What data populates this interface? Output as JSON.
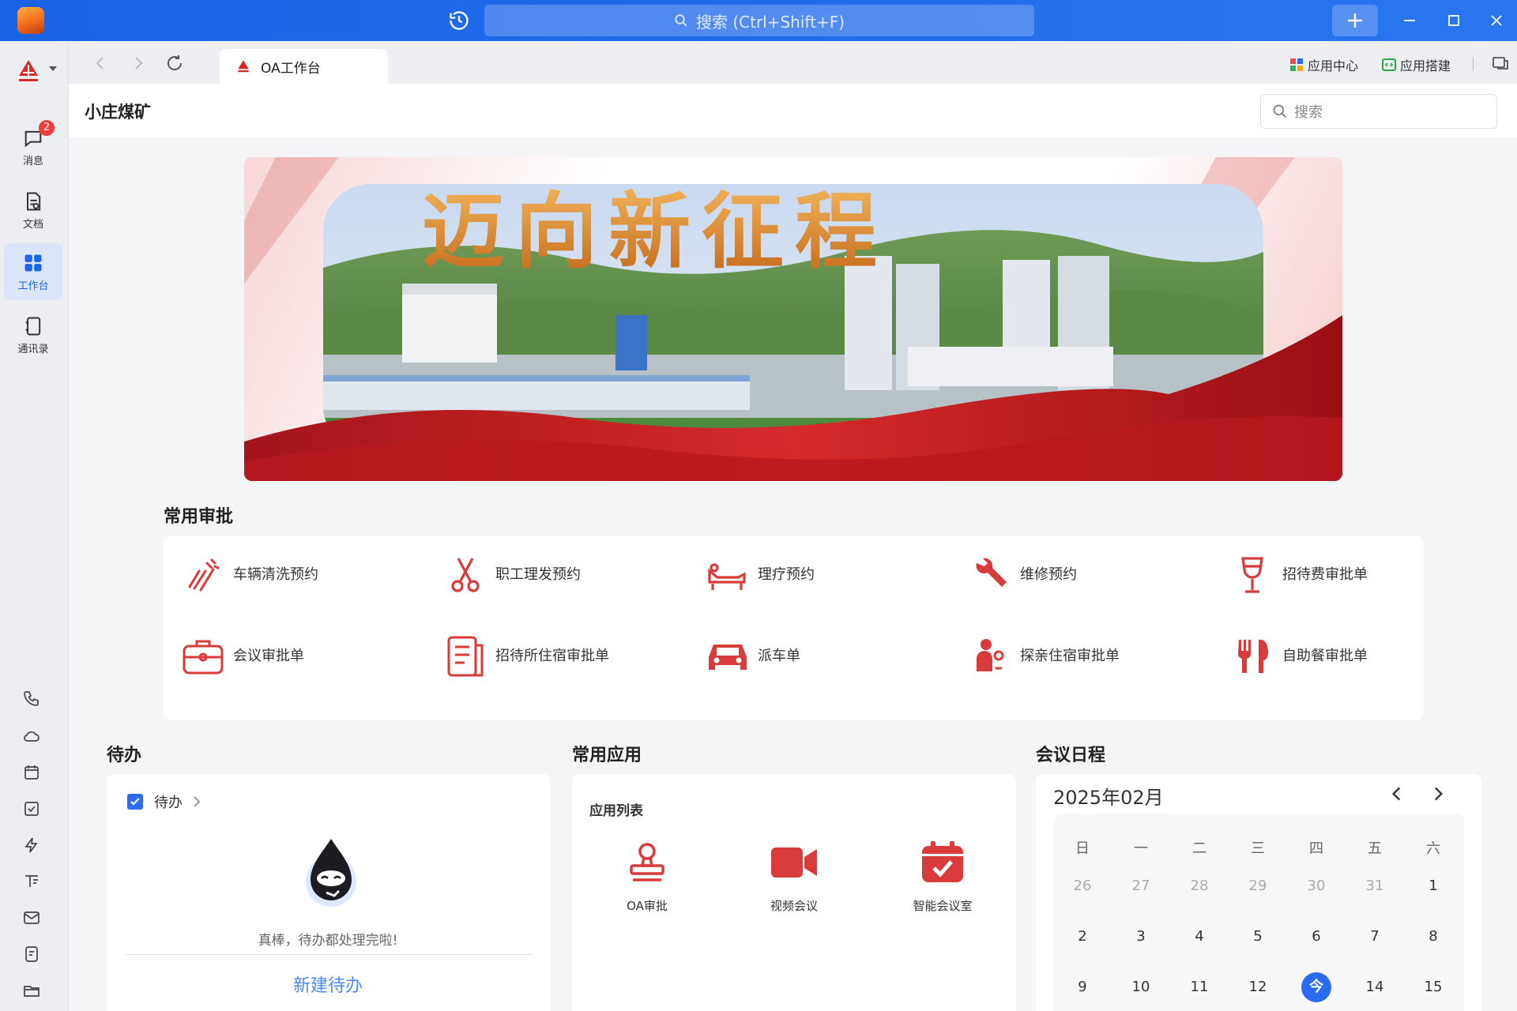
{
  "titlebar": {
    "search_placeholder": "搜索 (Ctrl+Shift+F)"
  },
  "nav": {
    "items": [
      {
        "label": "消息",
        "badge": "2"
      },
      {
        "label": "文档"
      },
      {
        "label": "工作台"
      },
      {
        "label": "通讯录"
      }
    ]
  },
  "tabbar": {
    "tab_label": "OA工作台",
    "links": [
      "应用中心",
      "应用搭建"
    ]
  },
  "header": {
    "title": "小庄煤矿",
    "search_placeholder": "搜索"
  },
  "banner": {
    "text": "迈向新征程"
  },
  "approvals": {
    "title": "常用审批",
    "items": [
      {
        "label": "车辆清洗预约",
        "icon": "car-wash-icon"
      },
      {
        "label": "职工理发预约",
        "icon": "scissors-icon"
      },
      {
        "label": "理疗预约",
        "icon": "massage-bed-icon"
      },
      {
        "label": "维修预约",
        "icon": "wrench-icon"
      },
      {
        "label": "招待费审批单",
        "icon": "wine-glass-icon"
      },
      {
        "label": "会议审批单",
        "icon": "briefcase-icon"
      },
      {
        "label": "招待所住宿审批单",
        "icon": "document-list-icon"
      },
      {
        "label": "派车单",
        "icon": "car-icon"
      },
      {
        "label": "探亲住宿审批单",
        "icon": "family-visit-icon"
      },
      {
        "label": "自助餐审批单",
        "icon": "cutlery-icon"
      }
    ]
  },
  "todo": {
    "title": "待办",
    "head_label": "待办",
    "empty_text": "真棒，待办都处理完啦!",
    "new_label": "新建待办"
  },
  "apps": {
    "title": "常用应用",
    "list_title": "应用列表",
    "items": [
      {
        "label": "OA审批",
        "icon": "stamp-icon"
      },
      {
        "label": "视频会议",
        "icon": "video-camera-icon"
      },
      {
        "label": "智能会议室",
        "icon": "calendar-check-icon"
      }
    ]
  },
  "calendar": {
    "title": "会议日程",
    "month": "2025年02月",
    "weekdays": [
      "日",
      "一",
      "二",
      "三",
      "四",
      "五",
      "六"
    ],
    "rows": [
      [
        "26",
        "27",
        "28",
        "29",
        "30",
        "31",
        "1"
      ],
      [
        "2",
        "3",
        "4",
        "5",
        "6",
        "7",
        "8"
      ],
      [
        "9",
        "10",
        "11",
        "12",
        "今",
        "14",
        "15"
      ]
    ]
  },
  "colors": {
    "titlebar": "#1a62e6",
    "accent": "#2a6bf2",
    "approval_icon": "#d93a3a",
    "badge": "#f23b3b"
  }
}
